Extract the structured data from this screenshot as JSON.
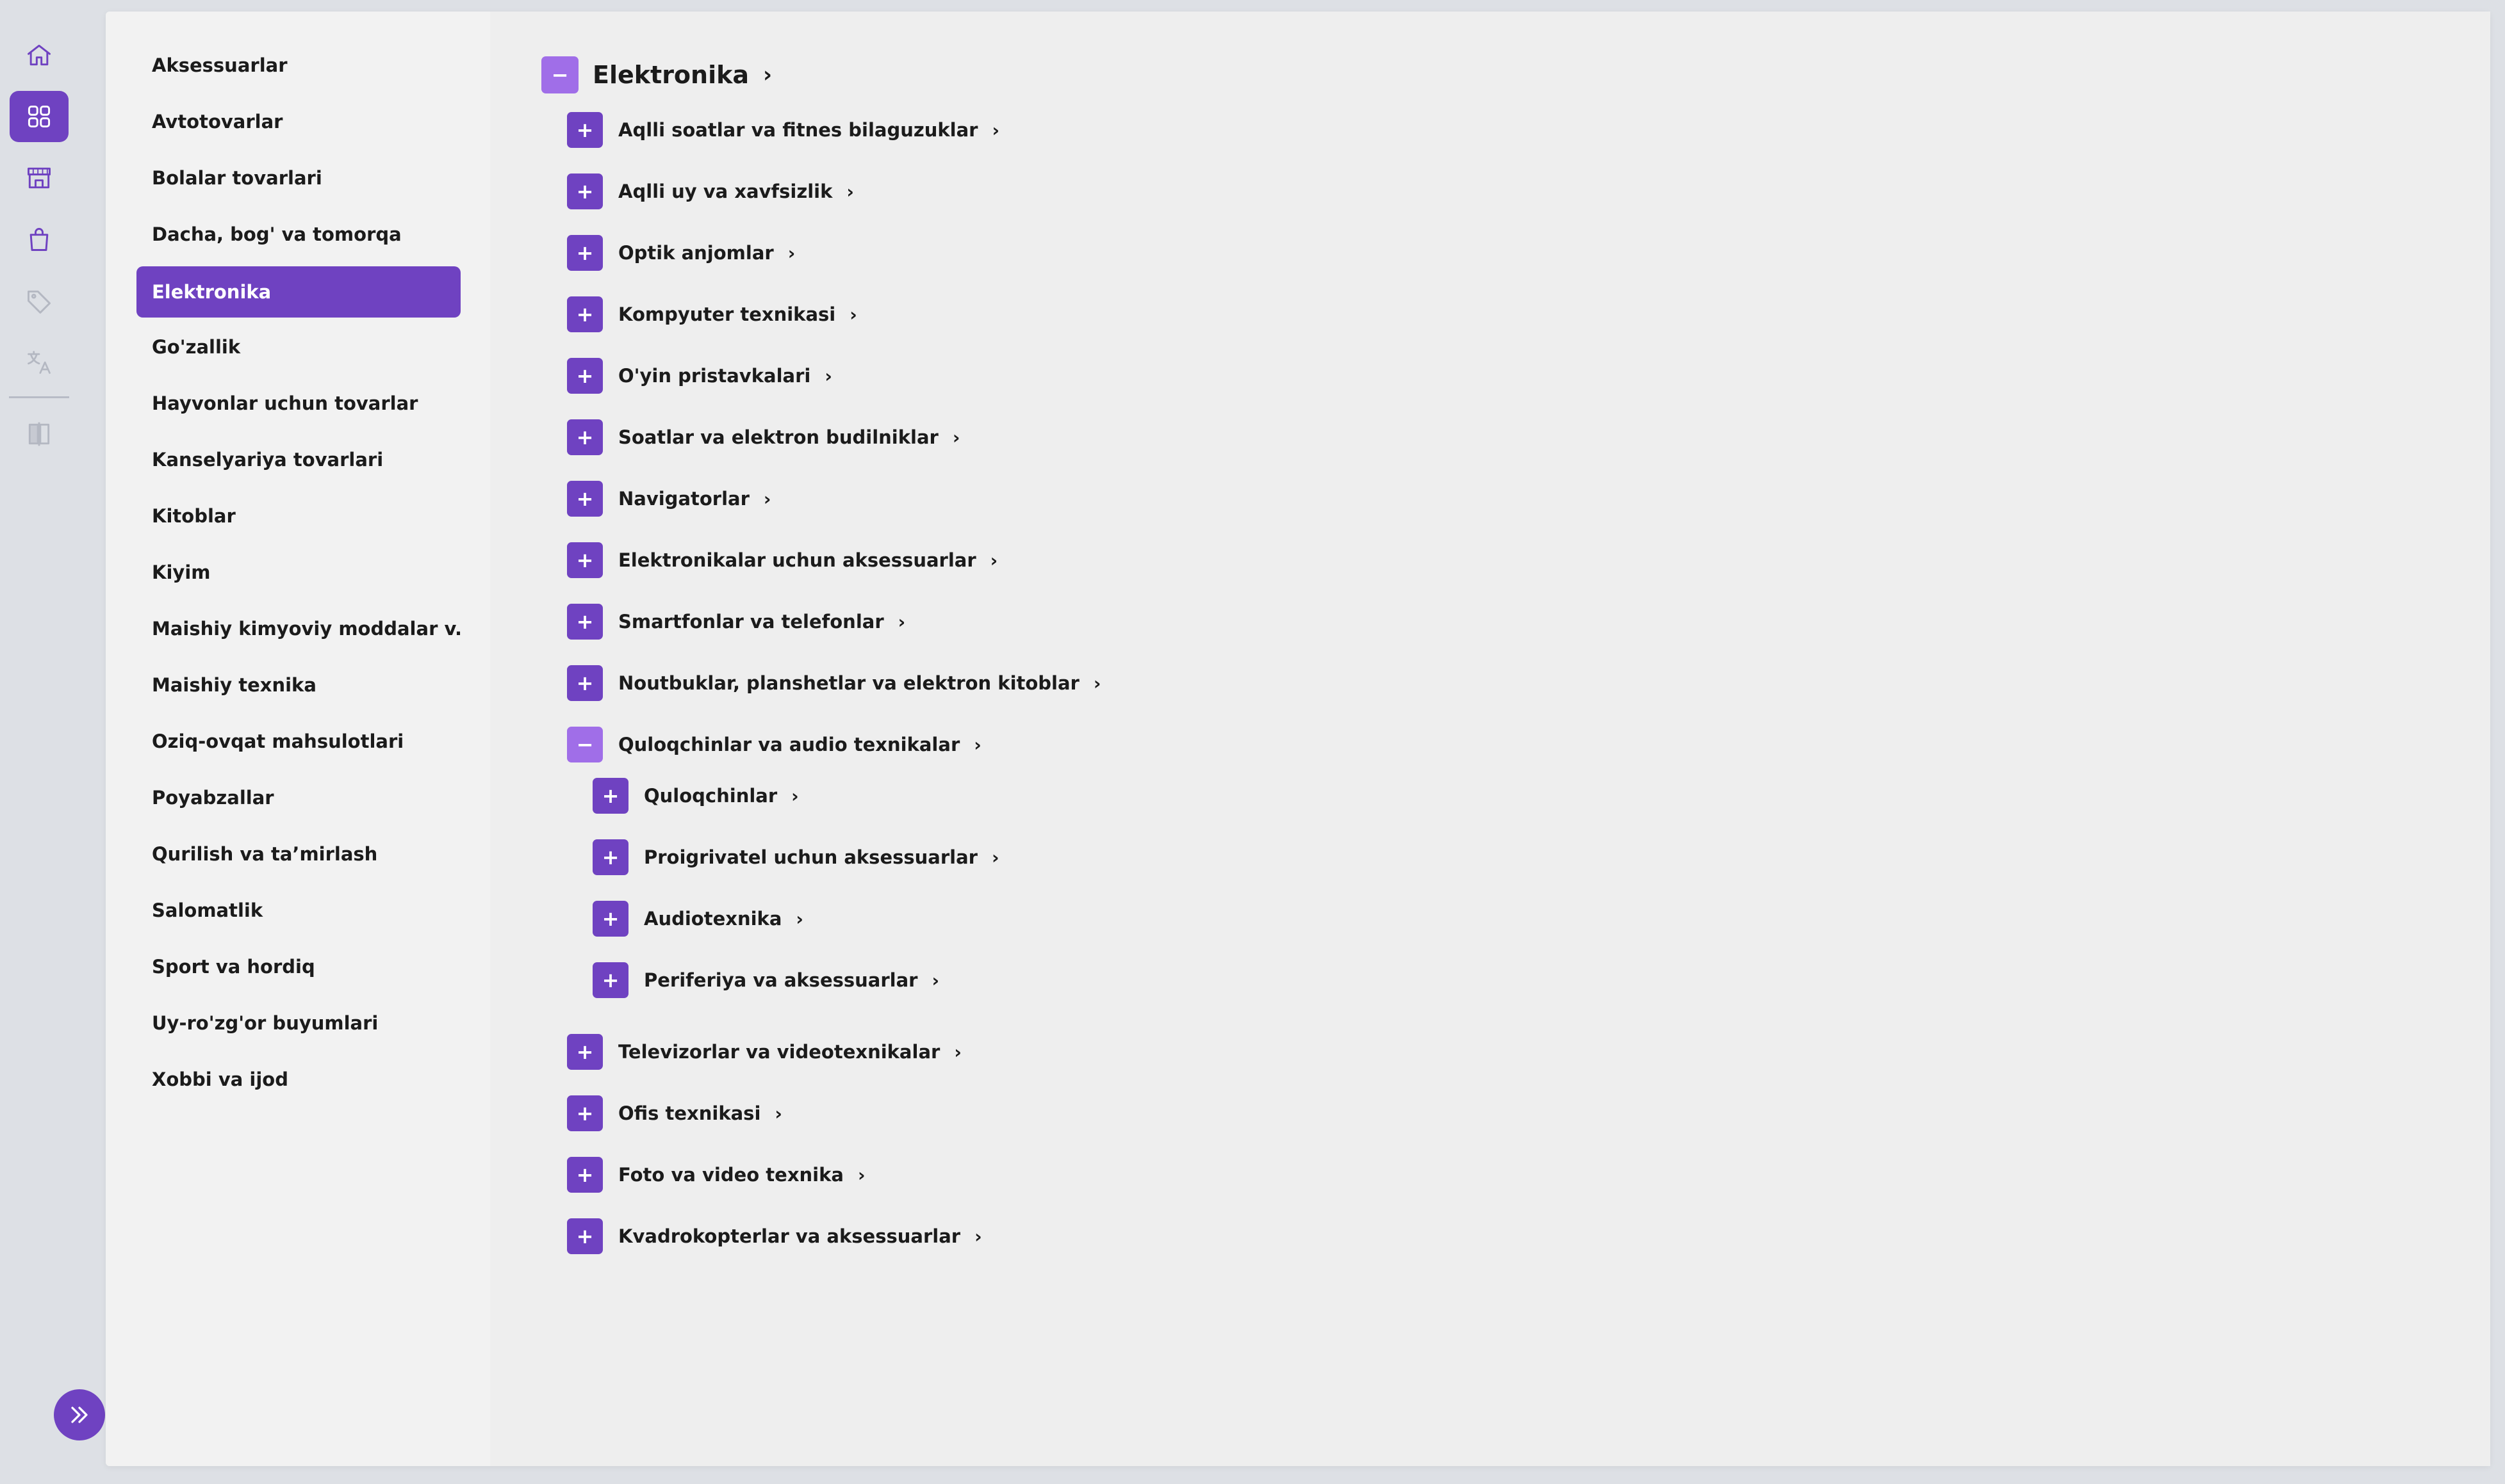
{
  "rail": {
    "icons": [
      "home-icon",
      "apps-grid-icon",
      "store-icon",
      "shopping-bag-icon",
      "tag-icon",
      "translate-icon",
      "compare-icon"
    ],
    "active_icon": "apps-grid-icon",
    "expand_icon": "double-chevron-right-icon"
  },
  "colors": {
    "accent": "#6f42c1",
    "accent_light": "#a06ee8",
    "background": "#dde0e5",
    "panel": "#efefef"
  },
  "categories": [
    {
      "label": "Aksessuarlar"
    },
    {
      "label": "Avtotovarlar"
    },
    {
      "label": "Bolalar tovarlari"
    },
    {
      "label": "Dacha, bog' va tomorqa"
    },
    {
      "label": "Elektronika"
    },
    {
      "label": "Go'zallik"
    },
    {
      "label": "Hayvonlar uchun tovarlar"
    },
    {
      "label": "Kanselyariya tovarlari"
    },
    {
      "label": "Kitoblar"
    },
    {
      "label": "Kiyim"
    },
    {
      "label": "Maishiy kimyoviy moddalar v..."
    },
    {
      "label": "Maishiy texnika"
    },
    {
      "label": "Oziq-ovqat mahsulotlari"
    },
    {
      "label": "Poyabzallar"
    },
    {
      "label": "Qurilish va ta’mirlash"
    },
    {
      "label": "Salomatlik"
    },
    {
      "label": "Sport va hordiq"
    },
    {
      "label": "Uy-ro'zg'or buyumlari"
    },
    {
      "label": "Xobbi va ijod"
    }
  ],
  "selected_category": "Elektronika",
  "tree": {
    "root": {
      "label": "Elektronika",
      "toggle": "−",
      "chevron": "›"
    },
    "items": [
      {
        "label": "Aqlli soatlar va fitnes bilaguzuklar",
        "toggle": "+",
        "chevron": "›"
      },
      {
        "label": "Aqlli uy va xavfsizlik",
        "toggle": "+",
        "chevron": "›"
      },
      {
        "label": "Optik anjomlar",
        "toggle": "+",
        "chevron": "›"
      },
      {
        "label": "Kompyuter texnikasi",
        "toggle": "+",
        "chevron": "›"
      },
      {
        "label": "O'yin pristavkalari",
        "toggle": "+",
        "chevron": "›"
      },
      {
        "label": "Soatlar va elektron budilniklar",
        "toggle": "+",
        "chevron": "›"
      },
      {
        "label": "Navigatorlar",
        "toggle": "+",
        "chevron": "›"
      },
      {
        "label": "Elektronikalar uchun aksessuarlar",
        "toggle": "+",
        "chevron": "›"
      },
      {
        "label": "Smartfonlar va telefonlar",
        "toggle": "+",
        "chevron": "›"
      },
      {
        "label": "Noutbuklar, planshetlar va elektron kitoblar",
        "toggle": "+",
        "chevron": "›"
      },
      {
        "label": "Quloqchinlar va audio texnikalar",
        "toggle": "−",
        "chevron": "›",
        "children": [
          {
            "label": "Quloqchinlar",
            "toggle": "+",
            "chevron": "›"
          },
          {
            "label": "Proigrivatel uchun aksessuarlar",
            "toggle": "+",
            "chevron": "›"
          },
          {
            "label": "Audiotexnika",
            "toggle": "+",
            "chevron": "›"
          },
          {
            "label": "Periferiya va aksessuarlar",
            "toggle": "+",
            "chevron": "›"
          }
        ]
      },
      {
        "label": "Televizorlar va videotexnikalar",
        "toggle": "+",
        "chevron": "›"
      },
      {
        "label": "Ofis texnikasi",
        "toggle": "+",
        "chevron": "›"
      },
      {
        "label": "Foto va video texnika",
        "toggle": "+",
        "chevron": "›"
      },
      {
        "label": "Kvadrokopterlar va aksessuarlar",
        "toggle": "+",
        "chevron": "›"
      }
    ]
  }
}
